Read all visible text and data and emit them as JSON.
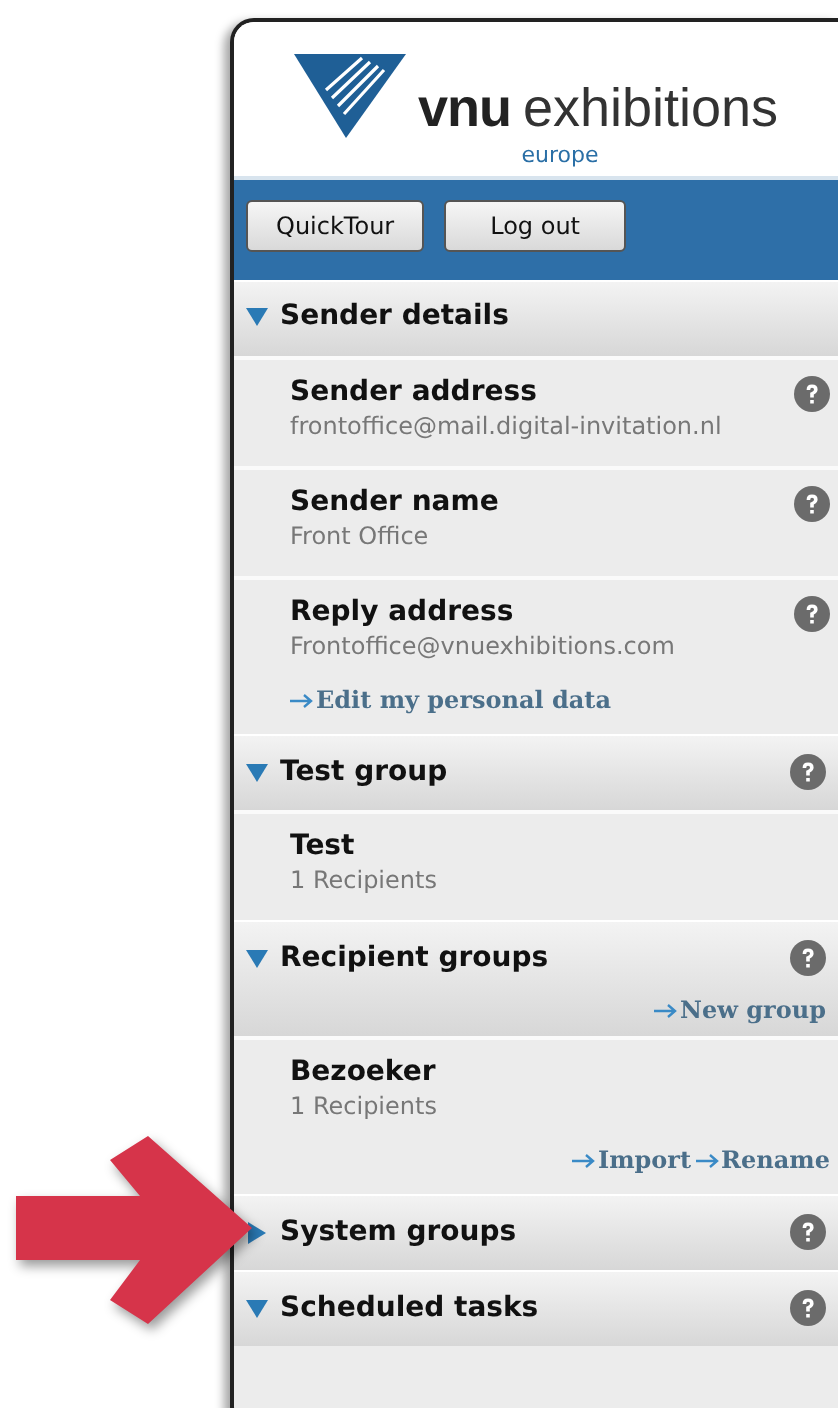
{
  "logo": {
    "brand": "vnu",
    "name": "exhibitions",
    "region": "europe"
  },
  "toolbar": {
    "buttons": [
      "QuickTour",
      "Log out"
    ]
  },
  "sections": [
    {
      "title": "Sender details",
      "expanded": true,
      "help": false,
      "items": [
        {
          "name": "Sender address",
          "detail": "frontoffice@mail.digital-invitation.nl",
          "help": true
        },
        {
          "name": "Sender name",
          "detail": "Front Office",
          "help": true
        },
        {
          "name": "Reply address",
          "detail": "Frontoffice@vnuexhibitions.com",
          "help": true,
          "links": [
            "Edit my personal data"
          ]
        }
      ]
    },
    {
      "title": "Test group",
      "expanded": true,
      "help": true,
      "items": [
        {
          "name": "Test",
          "detail": "1 Recipients",
          "help": false
        }
      ]
    },
    {
      "title": "Recipient groups",
      "expanded": true,
      "help": true,
      "links": [
        "New group"
      ],
      "items": [
        {
          "name": "Bezoeker",
          "detail": "1 Recipients",
          "help": false,
          "links": [
            "Import",
            "Rename"
          ]
        }
      ]
    },
    {
      "title": "System groups",
      "expanded": false,
      "help": true
    },
    {
      "title": "Scheduled tasks",
      "expanded": true,
      "help": true
    }
  ]
}
